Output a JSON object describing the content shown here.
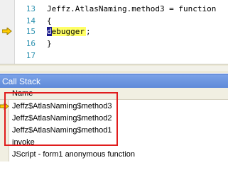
{
  "editor": {
    "lines": [
      {
        "number": "13",
        "text": "Jeffz.AtlasNaming.method3 = function"
      },
      {
        "number": "14",
        "text": "{"
      },
      {
        "number": "15",
        "text_first": "d",
        "text_rest": "ebugger",
        "text_suffix": ";"
      },
      {
        "number": "16",
        "text": "}"
      },
      {
        "number": "17",
        "text": ""
      }
    ],
    "execution_arrow_color": "#ffcc00",
    "highlight_color": "#ffff66"
  },
  "call_stack": {
    "title": "Call Stack",
    "column_name": "Name",
    "rows": [
      "Jeffz$AtlasNaming$method3",
      "Jeffz$AtlasNaming$method2",
      "Jeffz$AtlasNaming$method1",
      "invoke",
      "JScript - form1 anonymous function"
    ],
    "highlight_box_color": "#e01c1c"
  }
}
